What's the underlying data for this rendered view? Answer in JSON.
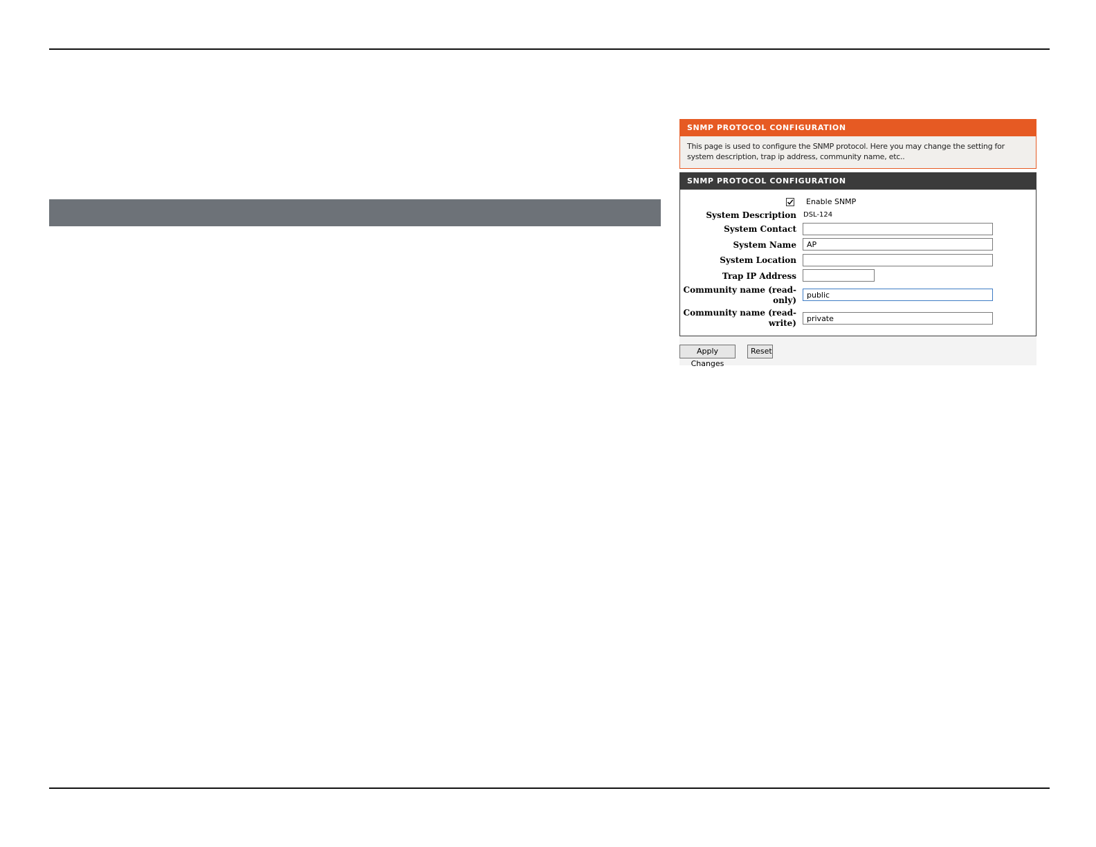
{
  "section1": {
    "title": "SNMP PROTOCOL CONFIGURATION",
    "description": "This page is used to configure the SNMP protocol. Here you may change the setting for system description, trap ip address, community name, etc.."
  },
  "section2": {
    "title": "SNMP PROTOCOL CONFIGURATION",
    "enable_snmp": {
      "label": "Enable SNMP",
      "checked": true
    },
    "system_description": {
      "label": "System Description",
      "value": "DSL-124"
    },
    "system_contact": {
      "label": "System Contact",
      "value": ""
    },
    "system_name": {
      "label": "System Name",
      "value": "AP"
    },
    "system_location": {
      "label": "System Location",
      "value": ""
    },
    "trap_ip": {
      "label": "Trap IP Address",
      "value": ""
    },
    "community_ro": {
      "label_line1": "Community name (read-",
      "label_line2": "only)",
      "value": "public"
    },
    "community_rw": {
      "label_line1": "Community name (read-",
      "label_line2": "write)",
      "value": "private"
    }
  },
  "buttons": {
    "apply": "Apply Changes",
    "reset": "Reset"
  },
  "colors": {
    "accent_orange": "#e65a23",
    "header_dark": "#3b3b3b",
    "band_gray": "#6d7278"
  }
}
